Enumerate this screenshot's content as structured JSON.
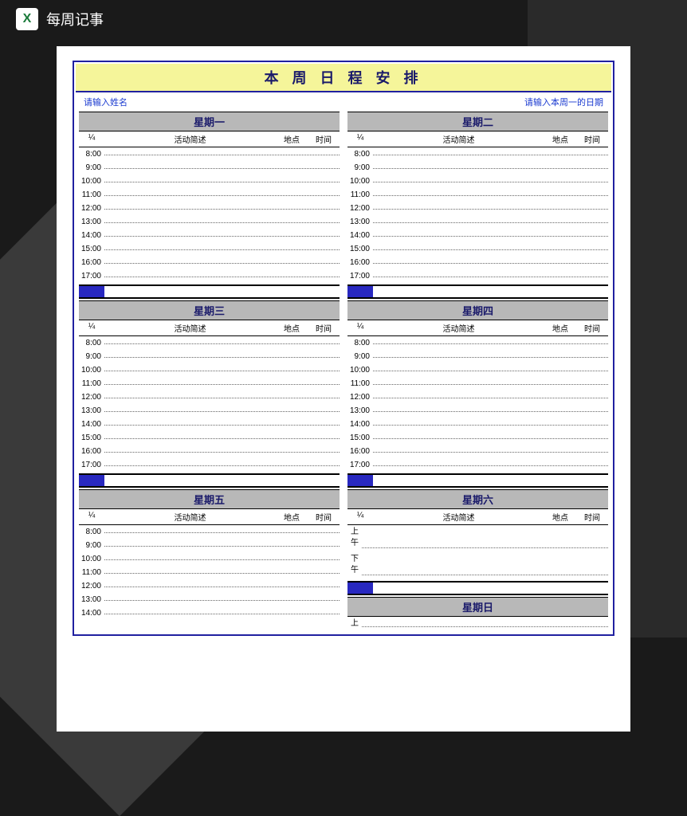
{
  "app": {
    "title": "每周记事"
  },
  "doc": {
    "main_title": "本 周 日 程 安 排",
    "name_placeholder": "请输入姓名",
    "date_placeholder": "请输入本周一的日期",
    "col_headers": {
      "time": "¼",
      "activity": "活动简述",
      "location": "地点",
      "duration": "时间"
    },
    "days": {
      "mon": "星期一",
      "tue": "星期二",
      "wed": "星期三",
      "thu": "星期四",
      "fri": "星期五",
      "sat": "星期六",
      "sun": "星期日"
    },
    "hours": [
      "8:00",
      "9:00",
      "10:00",
      "11:00",
      "12:00",
      "13:00",
      "14:00",
      "15:00",
      "16:00",
      "17:00"
    ],
    "fri_hours": [
      "8:00",
      "9:00",
      "10:00",
      "11:00",
      "12:00",
      "13:00",
      "14:00"
    ],
    "sat_periods": {
      "am": "上午",
      "pm": "下午"
    },
    "sun_first": "上"
  }
}
